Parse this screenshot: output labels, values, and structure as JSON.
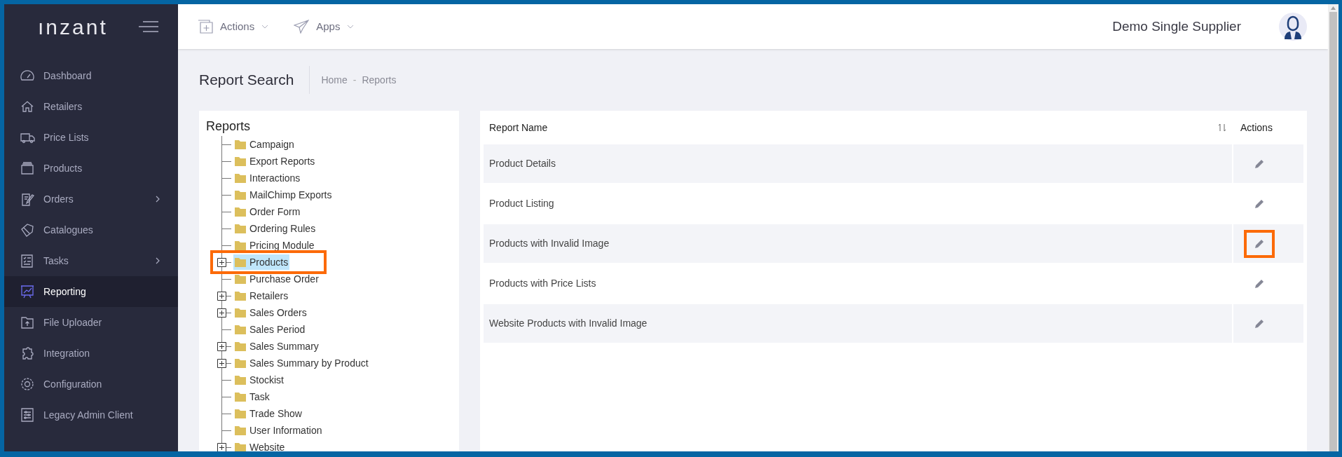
{
  "sidebar": {
    "logo": "ınzant",
    "items": [
      {
        "label": "Dashboard",
        "selected": false,
        "has_submenu": false
      },
      {
        "label": "Retailers",
        "selected": false,
        "has_submenu": false
      },
      {
        "label": "Price Lists",
        "selected": false,
        "has_submenu": false
      },
      {
        "label": "Products",
        "selected": false,
        "has_submenu": false
      },
      {
        "label": "Orders",
        "selected": false,
        "has_submenu": true
      },
      {
        "label": "Catalogues",
        "selected": false,
        "has_submenu": false
      },
      {
        "label": "Tasks",
        "selected": false,
        "has_submenu": true
      },
      {
        "label": "Reporting",
        "selected": true,
        "has_submenu": false
      },
      {
        "label": "File Uploader",
        "selected": false,
        "has_submenu": false
      },
      {
        "label": "Integration",
        "selected": false,
        "has_submenu": false
      },
      {
        "label": "Configuration",
        "selected": false,
        "has_submenu": false
      },
      {
        "label": "Legacy Admin Client",
        "selected": false,
        "has_submenu": false
      }
    ]
  },
  "header": {
    "menus": [
      "Actions",
      "Apps"
    ],
    "company": "Demo Single Supplier"
  },
  "page": {
    "title": "Report Search",
    "breadcrumb": [
      "Home",
      "Reports"
    ],
    "breadcrumb_separator": "-"
  },
  "tree": {
    "title": "Reports",
    "items": [
      {
        "label": "Campaign",
        "expandable": false,
        "selected": false,
        "highlighted": false
      },
      {
        "label": "Export Reports",
        "expandable": false,
        "selected": false,
        "highlighted": false
      },
      {
        "label": "Interactions",
        "expandable": false,
        "selected": false,
        "highlighted": false
      },
      {
        "label": "MailChimp Exports",
        "expandable": false,
        "selected": false,
        "highlighted": false
      },
      {
        "label": "Order Form",
        "expandable": false,
        "selected": false,
        "highlighted": false
      },
      {
        "label": "Ordering Rules",
        "expandable": false,
        "selected": false,
        "highlighted": false
      },
      {
        "label": "Pricing Module",
        "expandable": false,
        "selected": false,
        "highlighted": false
      },
      {
        "label": "Products",
        "expandable": true,
        "selected": true,
        "highlighted": true
      },
      {
        "label": "Purchase Order",
        "expandable": false,
        "selected": false,
        "highlighted": false
      },
      {
        "label": "Retailers",
        "expandable": true,
        "selected": false,
        "highlighted": false
      },
      {
        "label": "Sales Orders",
        "expandable": true,
        "selected": false,
        "highlighted": false
      },
      {
        "label": "Sales Period",
        "expandable": false,
        "selected": false,
        "highlighted": false
      },
      {
        "label": "Sales Summary",
        "expandable": true,
        "selected": false,
        "highlighted": false
      },
      {
        "label": "Sales Summary by Product",
        "expandable": true,
        "selected": false,
        "highlighted": false
      },
      {
        "label": "Stockist",
        "expandable": false,
        "selected": false,
        "highlighted": false
      },
      {
        "label": "Task",
        "expandable": false,
        "selected": false,
        "highlighted": false
      },
      {
        "label": "Trade Show",
        "expandable": false,
        "selected": false,
        "highlighted": false
      },
      {
        "label": "User Information",
        "expandable": false,
        "selected": false,
        "highlighted": false
      },
      {
        "label": "Website",
        "expandable": true,
        "selected": false,
        "highlighted": false
      }
    ]
  },
  "table": {
    "columns": [
      "Report Name",
      "Actions"
    ],
    "rows": [
      {
        "name": "Product Details",
        "highlighted": false
      },
      {
        "name": "Product Listing",
        "highlighted": false
      },
      {
        "name": "Products with Invalid Image",
        "highlighted": true
      },
      {
        "name": "Products with Price Lists",
        "highlighted": false
      },
      {
        "name": "Website Products with Invalid Image",
        "highlighted": false
      }
    ]
  }
}
